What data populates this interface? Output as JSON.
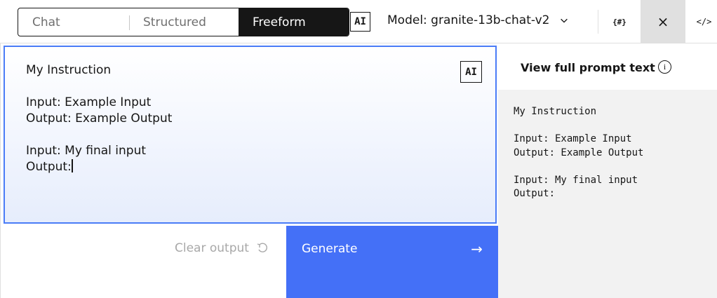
{
  "tabs": [
    {
      "label": "Chat"
    },
    {
      "label": "Structured"
    },
    {
      "label": "Freeform"
    }
  ],
  "header": {
    "ai_badge": "AI",
    "model_label": "Model: granite-13b-chat-v2",
    "hash_button": "{#}",
    "close_button": "×",
    "code_button": "</>"
  },
  "editor": {
    "ai_badge": "AI",
    "text": "My Instruction\n\nInput: Example Input\nOutput: Example Output\n\nInput: My final input\nOutput:"
  },
  "actions": {
    "clear_output_label": "Clear output",
    "generate_label": "Generate"
  },
  "prompt_panel": {
    "title": "View full prompt text",
    "info_icon": "i",
    "text": "My Instruction\n\nInput: Example Input\nOutput: Example Output\n\nInput: My final input\nOutput:"
  }
}
